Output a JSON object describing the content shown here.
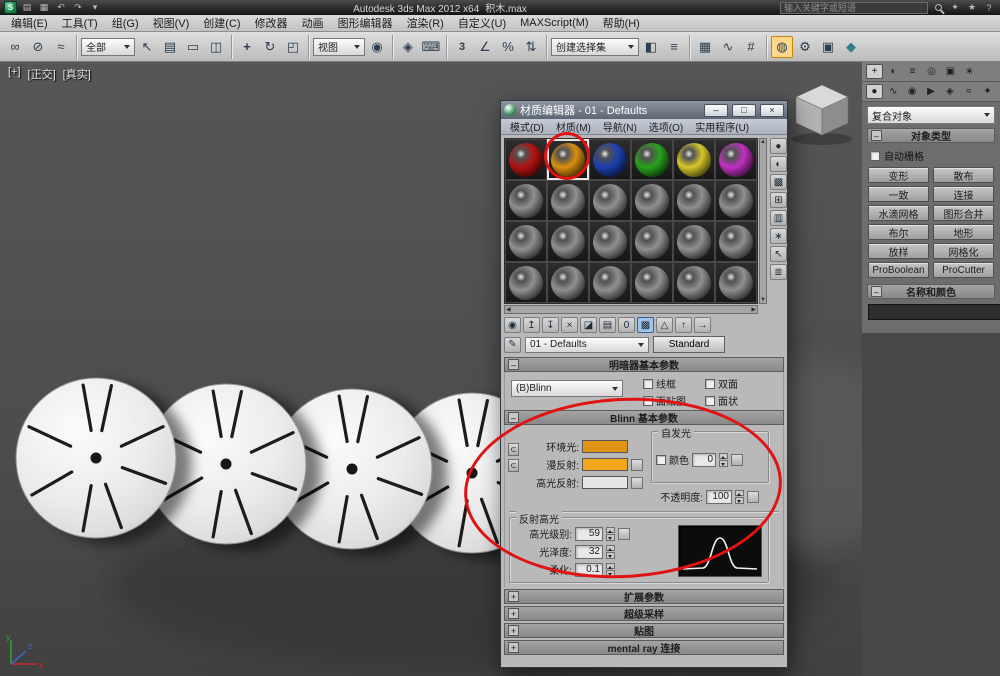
{
  "colors": {
    "annotation": "#e01212"
  },
  "titlebar": {
    "title": "Autodesk 3ds Max 2012 x64",
    "file": "积木.max",
    "search_placeholder": "输入关键字或短语"
  },
  "menubar": {
    "items": [
      "编辑(E)",
      "工具(T)",
      "组(G)",
      "视图(V)",
      "创建(C)",
      "修改器",
      "动画",
      "图形编辑器",
      "渲染(R)",
      "自定义(U)",
      "MAXScript(M)",
      "帮助(H)"
    ]
  },
  "toolbar": {
    "filter_value": "全部",
    "coord_value": "视图",
    "selset_value": "创建选择集"
  },
  "vp": {
    "general": "[+]",
    "pov": "[正交]",
    "shading": "[真实]"
  },
  "cp": {
    "category_value": "复合对象",
    "rollout_object_type": "对象类型",
    "autogrid": "自动栅格",
    "buttons": [
      "变形",
      "散布",
      "一致",
      "连接",
      "水滴网格",
      "图形合并",
      "布尔",
      "地形",
      "放样",
      "网格化",
      "ProBoolean",
      "ProCutter"
    ],
    "rollout_name_color": "名称和颜色"
  },
  "me": {
    "title": "材质编辑器 - 01 - Defaults",
    "menus": [
      "模式(D)",
      "材质(M)",
      "导航(N)",
      "选项(O)",
      "实用程序(U)"
    ],
    "selected_slot": 1,
    "sample_colors": [
      "#b31212",
      "#d98f10",
      "#1d40b0",
      "#27a31d",
      "#d6c72b",
      "#c130c1",
      null,
      null,
      null,
      null,
      null,
      null,
      null,
      null,
      null,
      null,
      null,
      null,
      null,
      null,
      null,
      null,
      null,
      null
    ],
    "name_value": "01 - Defaults",
    "type_button": "Standard",
    "roll_shader": "明暗器基本参数",
    "shader_dropdown": "(B)Blinn",
    "checks": [
      "线框",
      "双面",
      "面贴图",
      "面状"
    ],
    "roll_blinn": "Blinn 基本参数",
    "blinn": {
      "ambient": "环境光:",
      "diffuse": "漫反射:",
      "specular": "高光反射:",
      "ambient_color": "#e09314",
      "diffuse_color": "#f2a71a",
      "specular_color": "#e6e6e6",
      "selfillum": "自发光",
      "color_chk": "颜色",
      "selfillum_value": "0",
      "opacity": "不透明度:",
      "opacity_value": "100",
      "highlights": "反射高光",
      "spec_level": "高光级别:",
      "spec_level_value": "59",
      "gloss": "光泽度:",
      "gloss_value": "32",
      "soften": "柔化:",
      "soften_value": "0.1"
    },
    "rollups": [
      "扩展参数",
      "超级采样",
      "贴图",
      "mental ray 连接"
    ]
  }
}
